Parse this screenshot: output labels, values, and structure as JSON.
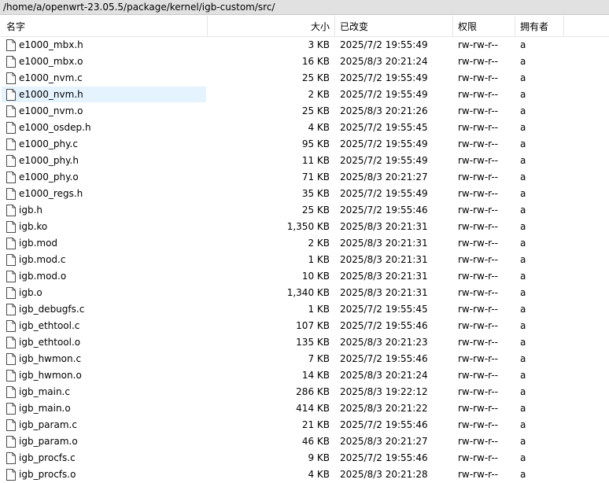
{
  "path": "/home/a/openwrt-23.05.5/package/kernel/igb-custom/src/",
  "columns": {
    "name": "名字",
    "size": "大小",
    "modified": "已改变",
    "permissions": "权限",
    "owner": "拥有者"
  },
  "sort_indicator": "^",
  "selected_index": 3,
  "files": [
    {
      "name": "e1000_mbx.h",
      "size": "3 KB",
      "modified": "2025/7/2 19:55:49",
      "permissions": "rw-rw-r--",
      "owner": "a"
    },
    {
      "name": "e1000_mbx.o",
      "size": "16 KB",
      "modified": "2025/8/3 20:21:24",
      "permissions": "rw-rw-r--",
      "owner": "a"
    },
    {
      "name": "e1000_nvm.c",
      "size": "25 KB",
      "modified": "2025/7/2 19:55:49",
      "permissions": "rw-rw-r--",
      "owner": "a"
    },
    {
      "name": "e1000_nvm.h",
      "size": "2 KB",
      "modified": "2025/7/2 19:55:49",
      "permissions": "rw-rw-r--",
      "owner": "a"
    },
    {
      "name": "e1000_nvm.o",
      "size": "25 KB",
      "modified": "2025/8/3 20:21:26",
      "permissions": "rw-rw-r--",
      "owner": "a"
    },
    {
      "name": "e1000_osdep.h",
      "size": "4 KB",
      "modified": "2025/7/2 19:55:45",
      "permissions": "rw-rw-r--",
      "owner": "a"
    },
    {
      "name": "e1000_phy.c",
      "size": "95 KB",
      "modified": "2025/7/2 19:55:49",
      "permissions": "rw-rw-r--",
      "owner": "a"
    },
    {
      "name": "e1000_phy.h",
      "size": "11 KB",
      "modified": "2025/7/2 19:55:49",
      "permissions": "rw-rw-r--",
      "owner": "a"
    },
    {
      "name": "e1000_phy.o",
      "size": "71 KB",
      "modified": "2025/8/3 20:21:27",
      "permissions": "rw-rw-r--",
      "owner": "a"
    },
    {
      "name": "e1000_regs.h",
      "size": "35 KB",
      "modified": "2025/7/2 19:55:49",
      "permissions": "rw-rw-r--",
      "owner": "a"
    },
    {
      "name": "igb.h",
      "size": "25 KB",
      "modified": "2025/7/2 19:55:46",
      "permissions": "rw-rw-r--",
      "owner": "a"
    },
    {
      "name": "igb.ko",
      "size": "1,350 KB",
      "modified": "2025/8/3 20:21:31",
      "permissions": "rw-rw-r--",
      "owner": "a"
    },
    {
      "name": "igb.mod",
      "size": "2 KB",
      "modified": "2025/8/3 20:21:31",
      "permissions": "rw-rw-r--",
      "owner": "a"
    },
    {
      "name": "igb.mod.c",
      "size": "1 KB",
      "modified": "2025/8/3 20:21:31",
      "permissions": "rw-rw-r--",
      "owner": "a"
    },
    {
      "name": "igb.mod.o",
      "size": "10 KB",
      "modified": "2025/8/3 20:21:31",
      "permissions": "rw-rw-r--",
      "owner": "a"
    },
    {
      "name": "igb.o",
      "size": "1,340 KB",
      "modified": "2025/8/3 20:21:31",
      "permissions": "rw-rw-r--",
      "owner": "a"
    },
    {
      "name": "igb_debugfs.c",
      "size": "1 KB",
      "modified": "2025/7/2 19:55:45",
      "permissions": "rw-rw-r--",
      "owner": "a"
    },
    {
      "name": "igb_ethtool.c",
      "size": "107 KB",
      "modified": "2025/7/2 19:55:46",
      "permissions": "rw-rw-r--",
      "owner": "a"
    },
    {
      "name": "igb_ethtool.o",
      "size": "135 KB",
      "modified": "2025/8/3 20:21:23",
      "permissions": "rw-rw-r--",
      "owner": "a"
    },
    {
      "name": "igb_hwmon.c",
      "size": "7 KB",
      "modified": "2025/7/2 19:55:46",
      "permissions": "rw-rw-r--",
      "owner": "a"
    },
    {
      "name": "igb_hwmon.o",
      "size": "14 KB",
      "modified": "2025/8/3 20:21:24",
      "permissions": "rw-rw-r--",
      "owner": "a"
    },
    {
      "name": "igb_main.c",
      "size": "286 KB",
      "modified": "2025/8/3 19:22:12",
      "permissions": "rw-rw-r--",
      "owner": "a"
    },
    {
      "name": "igb_main.o",
      "size": "414 KB",
      "modified": "2025/8/3 20:21:22",
      "permissions": "rw-rw-r--",
      "owner": "a"
    },
    {
      "name": "igb_param.c",
      "size": "21 KB",
      "modified": "2025/7/2 19:55:46",
      "permissions": "rw-rw-r--",
      "owner": "a"
    },
    {
      "name": "igb_param.o",
      "size": "46 KB",
      "modified": "2025/8/3 20:21:27",
      "permissions": "rw-rw-r--",
      "owner": "a"
    },
    {
      "name": "igb_procfs.c",
      "size": "9 KB",
      "modified": "2025/7/2 19:55:46",
      "permissions": "rw-rw-r--",
      "owner": "a"
    },
    {
      "name": "igb_procfs.o",
      "size": "4 KB",
      "modified": "2025/8/3 20:21:28",
      "permissions": "rw-rw-r--",
      "owner": "a"
    }
  ],
  "icons": {
    "file": "file-icon"
  },
  "colors": {
    "path_bar_bg": "#e1e1e1",
    "selection_bg": "#e5f3ff"
  }
}
